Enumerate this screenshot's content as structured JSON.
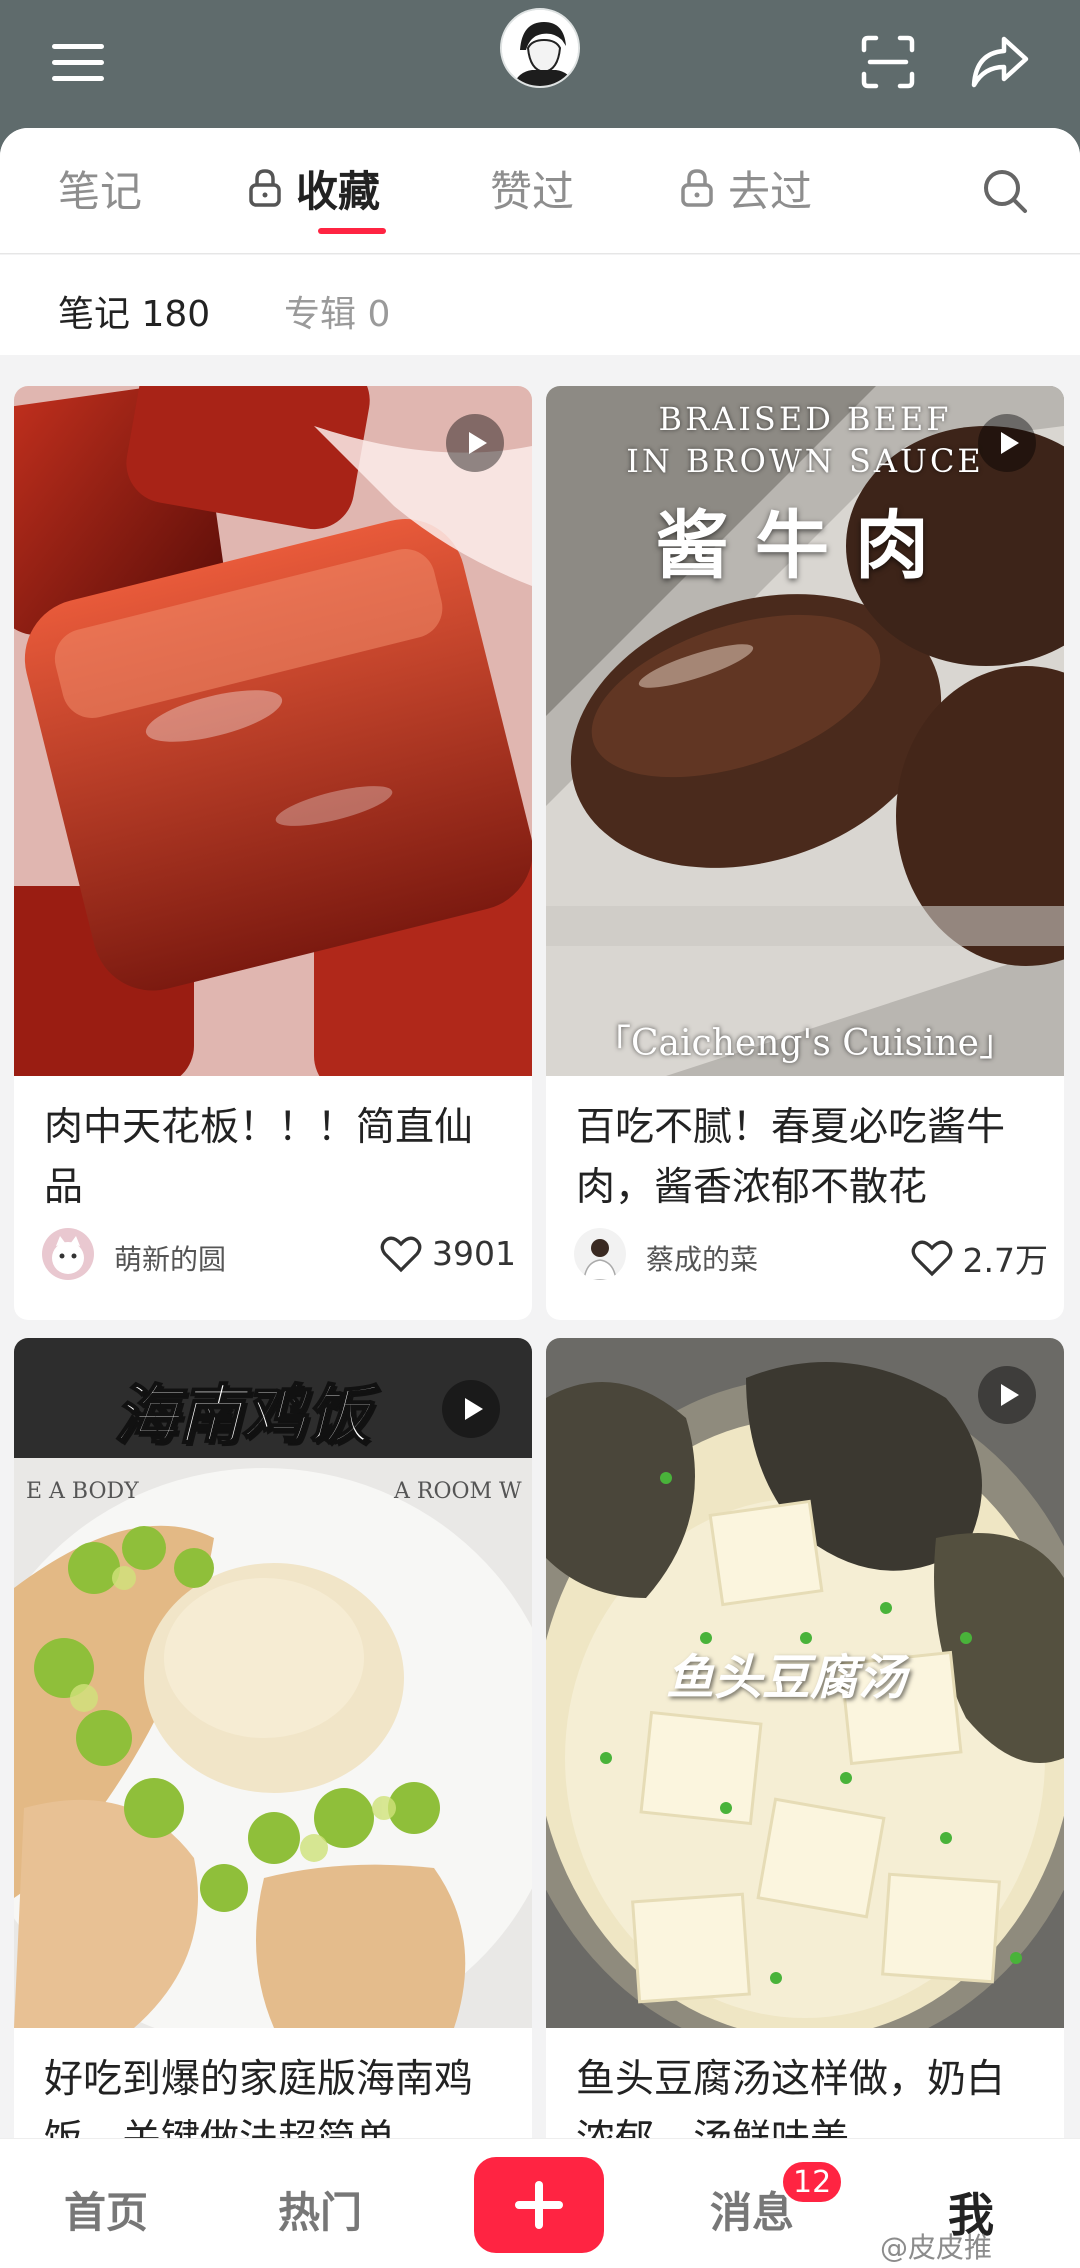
{
  "tabs": {
    "notes": "笔记",
    "collect": "收藏",
    "liked": "赞过",
    "visited": "去过"
  },
  "subtabs": {
    "notes": "笔记 180",
    "albums": "专辑 0"
  },
  "cards": [
    {
      "title": "肉中天花板！！！简直仙品",
      "author": "萌新的圆",
      "likes": "3901",
      "cover_text": []
    },
    {
      "title": "百吃不腻！春夏必吃酱牛肉，酱香浓郁不散花",
      "author": "蔡成的菜",
      "likes": "2.7万",
      "cover_text": [
        "BRAISED BEEF",
        "IN BROWN SAUCE",
        "酱牛肉",
        "「Caicheng's Cuisine」"
      ]
    },
    {
      "title": "好吃到爆的家庭版海南鸡饭，关键做法超简单",
      "author": "",
      "likes": "",
      "cover_text": [
        "海南鸡饭"
      ]
    },
    {
      "title": "鱼头豆腐汤这样做，奶白浓郁，汤鲜味美",
      "author": "",
      "likes": "",
      "cover_text": [
        "鱼头豆腐汤"
      ]
    }
  ],
  "nav": {
    "home": "首页",
    "hot": "热门",
    "messages": "消息",
    "messages_badge": "12",
    "me": "我"
  },
  "watermark": "@皮皮推",
  "colors": {
    "accent": "#ff2442",
    "topbar": "#5f6b6c"
  },
  "icons": [
    "menu-icon",
    "scan-icon",
    "share-icon",
    "lock-icon",
    "search-icon",
    "play-icon",
    "heart-icon",
    "plus-icon"
  ]
}
